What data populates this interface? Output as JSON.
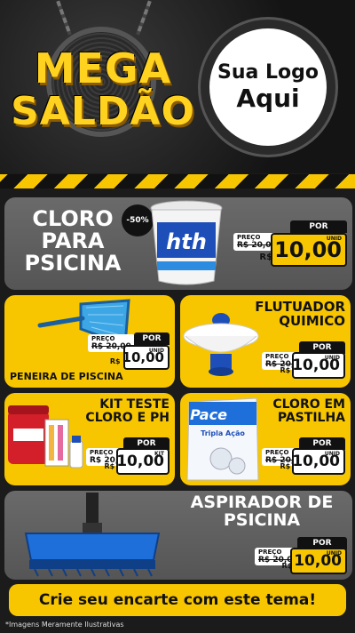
{
  "header": {
    "mega_line1": "MEGA",
    "mega_line2": "SALDÃO",
    "logo_line1": "Sua Logo",
    "logo_line2": "Aqui"
  },
  "products": [
    {
      "title_lines": [
        "CLORO",
        "PARA",
        "PSICINA"
      ],
      "discount": "-50%",
      "image_brand": "hth",
      "price_label": "PREÇO",
      "old_price": "R$ 20,00",
      "por_label": "POR",
      "currency": "R$",
      "new_price": "10,00",
      "unit": "UNID"
    },
    {
      "title_lines": [
        "PENEIRA DE PISCINA"
      ],
      "price_label": "PREÇO",
      "old_price": "R$ 20,00",
      "por_label": "POR",
      "currency": "R$",
      "new_price": "10,00",
      "unit": "UNID"
    },
    {
      "title_lines": [
        "FLUTUADOR",
        "QUIMICO"
      ],
      "price_label": "PREÇO",
      "old_price": "R$ 20,00",
      "por_label": "POR",
      "currency": "R$",
      "new_price": "10,00",
      "unit": "UNID"
    },
    {
      "title_lines": [
        "KIT TESTE",
        "CLORO E PH"
      ],
      "price_label": "PREÇO",
      "old_price": "R$ 20,00",
      "por_label": "POR",
      "currency": "R$",
      "new_price": "10,00",
      "unit": "KIT"
    },
    {
      "title_lines": [
        "CLORO EM",
        "PASTILHA"
      ],
      "image_brand": "Pace",
      "image_sub": "Tripla Ação",
      "price_label": "PREÇO",
      "old_price": "R$ 20,00",
      "por_label": "POR",
      "currency": "R$",
      "new_price": "10,00",
      "unit": "UNID"
    },
    {
      "title_lines": [
        "ASPIRADOR DE",
        "PSICINA"
      ],
      "price_label": "PREÇO",
      "old_price": "R$ 20,00",
      "por_label": "POR",
      "currency": "R$",
      "new_price": "10,00",
      "unit": "UNID"
    }
  ],
  "footer": {
    "cta": "Crie seu encarte com este tema!",
    "disclaimer": "*Imagens Meramente Ilustrativas"
  },
  "colors": {
    "accent": "#f7c600",
    "dark": "#111111",
    "card_gray": "#5f5f5f",
    "pool_blue": "#1e6fd9"
  }
}
